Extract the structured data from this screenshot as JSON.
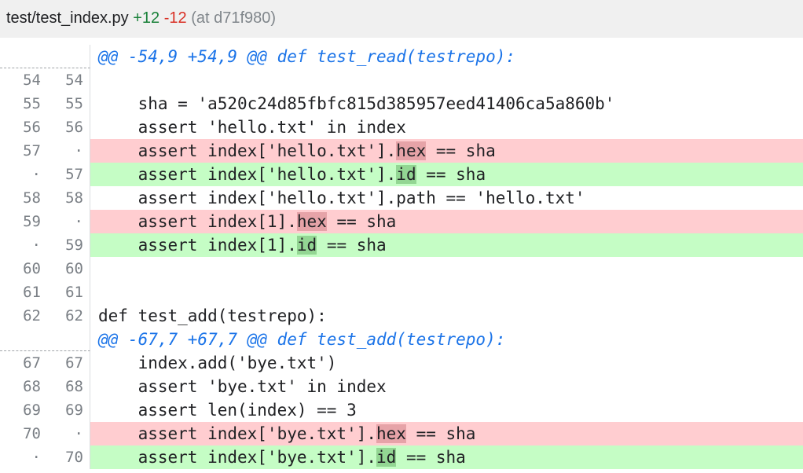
{
  "header": {
    "filename": "test/test_index.py",
    "added": "+12",
    "removed": "-12",
    "meta": "(at d71f980)"
  },
  "rows": [
    {
      "type": "hunk",
      "old": "",
      "new": "",
      "text": "@@ -54,9 +54,9 @@ def test_read(testrepo):"
    },
    {
      "type": "ctx",
      "old": "54",
      "new": "54",
      "text": ""
    },
    {
      "type": "ctx",
      "old": "55",
      "new": "55",
      "text": "    sha = 'a520c24d85fbfc815d385957eed41406ca5a860b'"
    },
    {
      "type": "ctx",
      "old": "56",
      "new": "56",
      "text": "    assert 'hello.txt' in index"
    },
    {
      "type": "del",
      "old": "57",
      "new": "·",
      "pre": "    assert index['hello.txt'].",
      "hl": "hex",
      "post": " == sha"
    },
    {
      "type": "ins",
      "old": "·",
      "new": "57",
      "pre": "    assert index['hello.txt'].",
      "hl": "id",
      "post": " == sha"
    },
    {
      "type": "ctx",
      "old": "58",
      "new": "58",
      "text": "    assert index['hello.txt'].path == 'hello.txt'"
    },
    {
      "type": "del",
      "old": "59",
      "new": "·",
      "pre": "    assert index[1].",
      "hl": "hex",
      "post": " == sha"
    },
    {
      "type": "ins",
      "old": "·",
      "new": "59",
      "pre": "    assert index[1].",
      "hl": "id",
      "post": " == sha"
    },
    {
      "type": "ctx",
      "old": "60",
      "new": "60",
      "text": ""
    },
    {
      "type": "ctx",
      "old": "61",
      "new": "61",
      "text": ""
    },
    {
      "type": "ctx",
      "old": "62",
      "new": "62",
      "text": "def test_add(testrepo):"
    },
    {
      "type": "hunk",
      "old": "",
      "new": "",
      "text": "@@ -67,7 +67,7 @@ def test_add(testrepo):"
    },
    {
      "type": "ctx",
      "old": "67",
      "new": "67",
      "text": "    index.add('bye.txt')"
    },
    {
      "type": "ctx",
      "old": "68",
      "new": "68",
      "text": "    assert 'bye.txt' in index"
    },
    {
      "type": "ctx",
      "old": "69",
      "new": "69",
      "text": "    assert len(index) == 3"
    },
    {
      "type": "del",
      "old": "70",
      "new": "·",
      "pre": "    assert index['bye.txt'].",
      "hl": "hex",
      "post": " == sha"
    },
    {
      "type": "ins",
      "old": "·",
      "new": "70",
      "pre": "    assert index['bye.txt'].",
      "hl": "id",
      "post": " == sha"
    }
  ]
}
